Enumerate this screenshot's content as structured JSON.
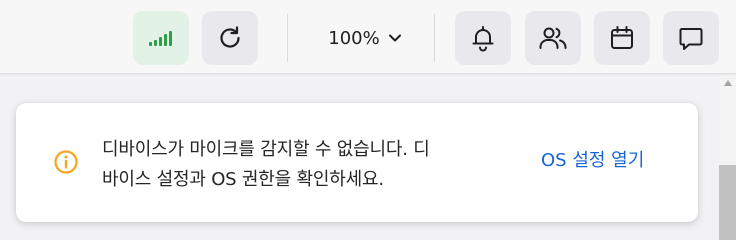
{
  "toolbar": {
    "signal": {
      "icon": "signal-strength-icon",
      "color": "#2e9e4a"
    },
    "refresh": {
      "icon": "refresh-icon"
    },
    "zoom": {
      "value": "100%",
      "icon": "chevron-down-icon"
    },
    "notifications": {
      "icon": "bell-icon"
    },
    "participants": {
      "icon": "people-icon"
    },
    "calendar": {
      "icon": "calendar-icon"
    },
    "chat": {
      "icon": "chat-bubble-icon"
    }
  },
  "banner": {
    "icon": "info-warning-icon",
    "icon_color": "#f5a623",
    "message": "디바이스가 마이크를 감지할 수 없습니다. 디바이스 설정과 OS 권한을 확인하세요.",
    "action_label": "OS 설정 열기",
    "action_color": "#1565d8"
  }
}
